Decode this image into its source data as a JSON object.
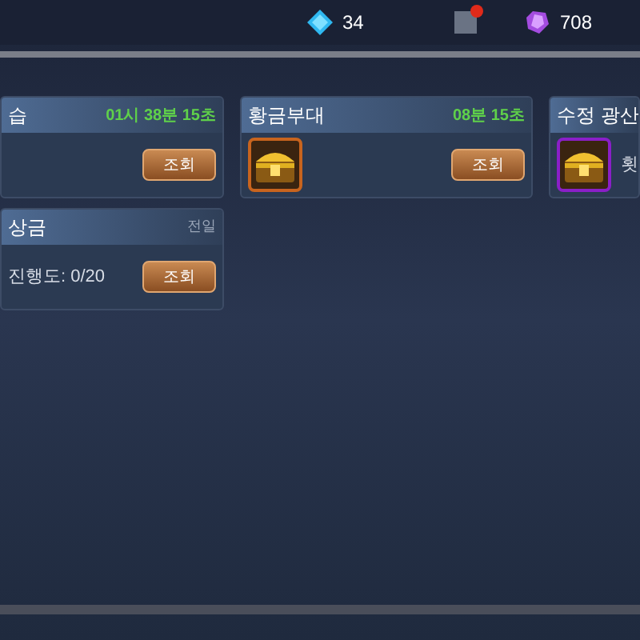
{
  "currency": [
    {
      "kind": "diamond",
      "amount": "34"
    },
    {
      "kind": "crystal",
      "amount": "708"
    }
  ],
  "mailbox": {
    "notification": true
  },
  "rows": [
    {
      "cards": [
        {
          "title": "습",
          "timer": "01시 38분 15초",
          "button": "조회"
        },
        {
          "title": "황금부대",
          "timer": "08분 15초",
          "chest": {
            "color": "#c8641e"
          },
          "button": "조회"
        },
        {
          "title": "수정 광산",
          "chest": {
            "color": "#8a1fc8"
          },
          "info": "횟"
        }
      ]
    },
    {
      "cards": [
        {
          "title": "상금",
          "note": "전일",
          "info": "진행도: 0/20",
          "button": "조회"
        }
      ]
    }
  ]
}
